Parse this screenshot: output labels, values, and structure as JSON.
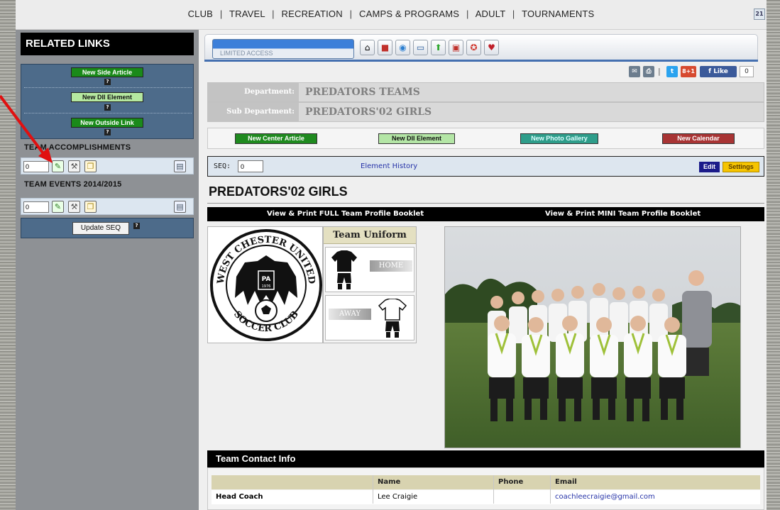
{
  "topnav": {
    "items": [
      "CLUB",
      "TRAVEL",
      "RECREATION",
      "CAMPS & PROGRAMS",
      "ADULT",
      "TOURNAMENTS"
    ],
    "separator": "|",
    "calendar_day": "21"
  },
  "sidebar": {
    "header": "RELATED LINKS",
    "buttons": [
      "New Side Article",
      "New DII Element",
      "New Outside Link"
    ],
    "help_mark": "?",
    "sections": [
      {
        "title": "TEAM ACCOMPLISHMENTS",
        "seq": "0"
      },
      {
        "title": "TEAM EVENTS 2014/2015",
        "seq": "0"
      }
    ],
    "update_label": "Update SEQ"
  },
  "tabbar": {
    "limited_label": "LIMITED ACCESS",
    "icons": [
      "home-icon",
      "toolbox-icon",
      "globe-icon",
      "monitor-icon",
      "arrow-up-icon",
      "contact-card-icon",
      "lifebuoy-icon",
      "heart-icon"
    ]
  },
  "social": {
    "fb_label": "Like",
    "fb_count": "0",
    "gplus": "8+1"
  },
  "department": {
    "label": "Department:",
    "value": "PREDATORS TEAMS"
  },
  "sub_department": {
    "label": "Sub Department:",
    "value": "PREDATORS'02 GIRLS"
  },
  "new_buttons": {
    "center_article": "New Center Article",
    "dii_element": "New DII Element",
    "photo_gallery": "New Photo Gallery",
    "calendar": "New Calendar"
  },
  "seqbar": {
    "label": "SEQ:",
    "value": "0",
    "history": "Element History",
    "edit": "Edit",
    "settings": "Settings"
  },
  "team_title": "PREDATORS'02 GIRLS",
  "booklet": {
    "full": "View & Print FULL Team Profile Booklet",
    "mini": "View & Print MINI Team Profile Booklet"
  },
  "logo": {
    "text_top": "WEST CHESTER UNITED",
    "text_bottom": "SOCCER CLUB",
    "state": "PA",
    "year": "1976"
  },
  "uniform": {
    "title": "Team Uniform",
    "home": "HOME",
    "away": "AWAY"
  },
  "contact": {
    "header": "Team Contact Info",
    "columns": [
      "",
      "Name",
      "Phone",
      "Email"
    ],
    "rows": [
      {
        "role": "Head Coach",
        "name": "Lee Craigie",
        "phone": "",
        "email": "coachleecraigie@gmail.com"
      }
    ]
  }
}
